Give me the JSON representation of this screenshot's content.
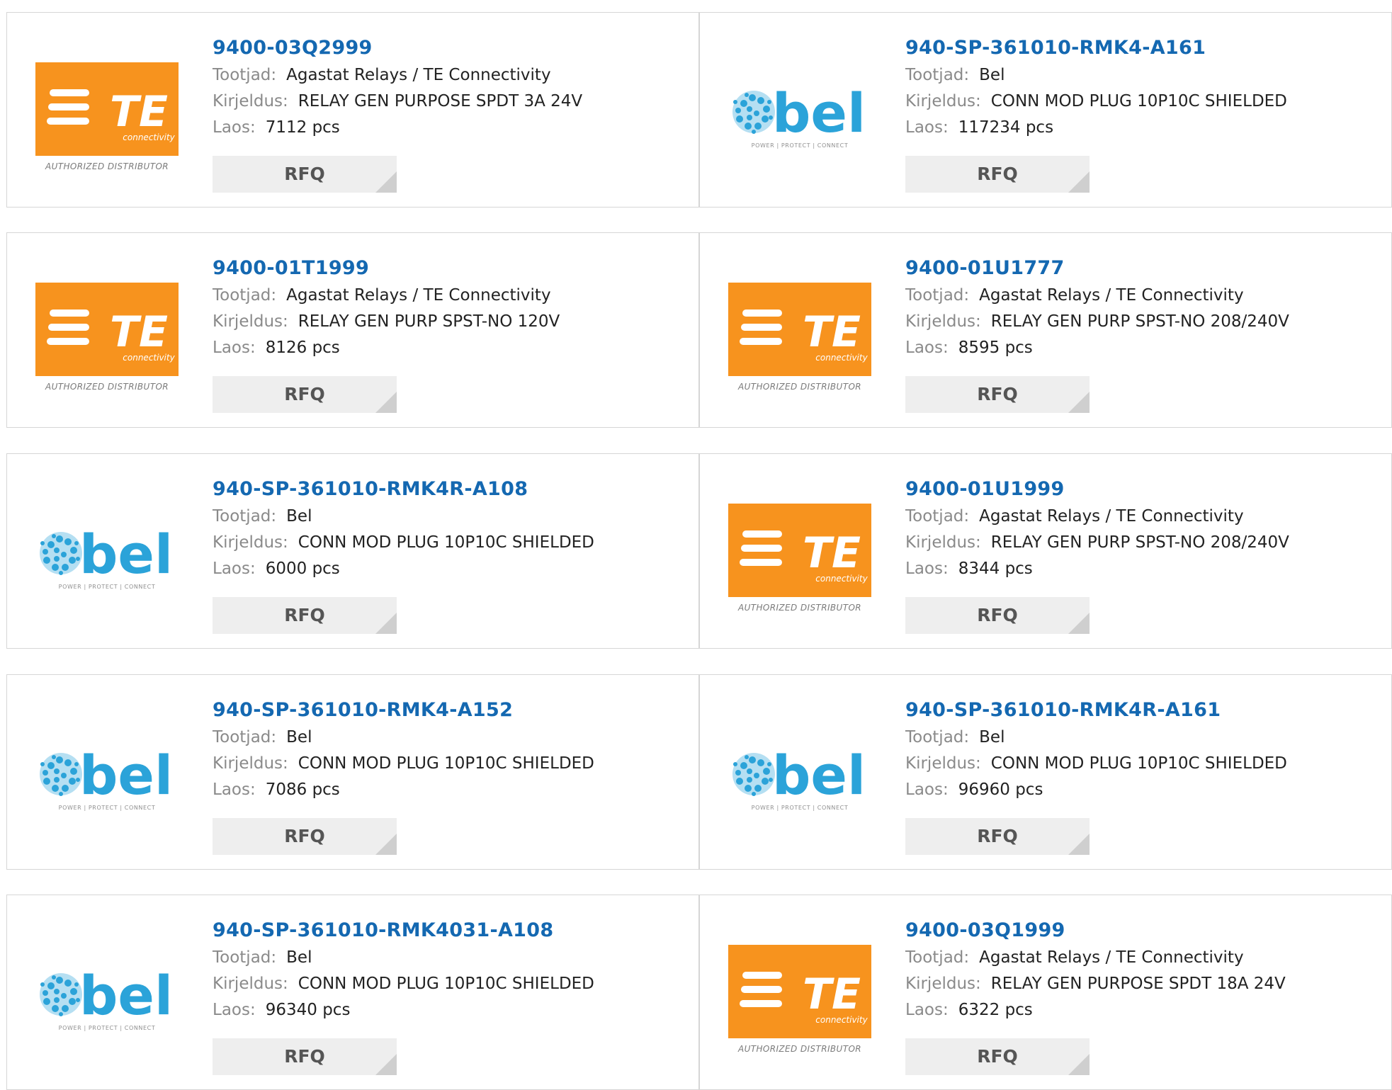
{
  "labels": {
    "manufacturer": "Tootjad:",
    "description": "Kirjeldus:",
    "stock": "Laos:",
    "rfq": "RFQ"
  },
  "logos": {
    "te": {
      "name": "TE",
      "sub": "connectivity",
      "caption": "AUTHORIZED DISTRIBUTOR",
      "color": "#f7931e"
    },
    "bel": {
      "name": "bel",
      "tagline": "POWER | PROTECT | CONNECT",
      "color": "#2ba3d9"
    }
  },
  "colors": {
    "link": "#1468b1",
    "label": "#8a8a8a",
    "button_bg": "#eeeeee",
    "border": "#d6d6d6"
  },
  "products": [
    {
      "logo": "te",
      "part": "9400-03Q2999",
      "manufacturer": "Agastat Relays / TE Connectivity",
      "description": "RELAY GEN PURPOSE SPDT 3A 24V",
      "stock": "7112 pcs"
    },
    {
      "logo": "bel",
      "part": "940-SP-361010-RMK4-A161",
      "manufacturer": "Bel",
      "description": "CONN MOD PLUG 10P10C SHIELDED",
      "stock": "117234 pcs"
    },
    {
      "logo": "te",
      "part": "9400-01T1999",
      "manufacturer": "Agastat Relays / TE Connectivity",
      "description": "RELAY GEN PURP SPST-NO 120V",
      "stock": "8126 pcs"
    },
    {
      "logo": "te",
      "part": "9400-01U1777",
      "manufacturer": "Agastat Relays / TE Connectivity",
      "description": "RELAY GEN PURP SPST-NO 208/240V",
      "stock": "8595 pcs"
    },
    {
      "logo": "bel",
      "part": "940-SP-361010-RMK4R-A108",
      "manufacturer": "Bel",
      "description": "CONN MOD PLUG 10P10C SHIELDED",
      "stock": "6000 pcs"
    },
    {
      "logo": "te",
      "part": "9400-01U1999",
      "manufacturer": "Agastat Relays / TE Connectivity",
      "description": "RELAY GEN PURP SPST-NO 208/240V",
      "stock": "8344 pcs"
    },
    {
      "logo": "bel",
      "part": "940-SP-361010-RMK4-A152",
      "manufacturer": "Bel",
      "description": "CONN MOD PLUG 10P10C SHIELDED",
      "stock": "7086 pcs"
    },
    {
      "logo": "bel",
      "part": "940-SP-361010-RMK4R-A161",
      "manufacturer": "Bel",
      "description": "CONN MOD PLUG 10P10C SHIELDED",
      "stock": "96960 pcs"
    },
    {
      "logo": "bel",
      "part": "940-SP-361010-RMK4031-A108",
      "manufacturer": "Bel",
      "description": "CONN MOD PLUG 10P10C SHIELDED",
      "stock": "96340 pcs"
    },
    {
      "logo": "te",
      "part": "9400-03Q1999",
      "manufacturer": "Agastat Relays / TE Connectivity",
      "description": "RELAY GEN PURPOSE SPDT 18A 24V",
      "stock": "6322 pcs"
    }
  ]
}
